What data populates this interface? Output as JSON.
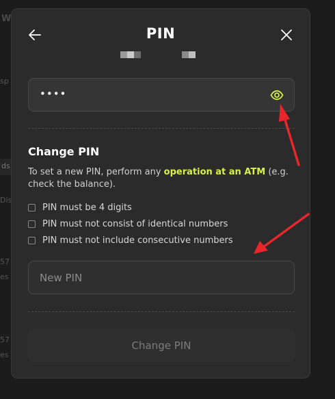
{
  "background": {
    "fragments": [
      "W",
      "sp",
      "ds",
      "Dis",
      "57",
      "es",
      "57",
      "es"
    ]
  },
  "modal": {
    "title": "PIN",
    "back_icon": "arrow-left-icon",
    "close_icon": "close-icon",
    "pin_field": {
      "value": "••••",
      "eye_icon": "eye-icon"
    },
    "change_pin": {
      "heading": "Change PIN",
      "description_prefix": "To set a new PIN, perform any ",
      "description_highlight": "operation at an ATM",
      "description_suffix": " (e.g. check the balance).",
      "highlight_color": "#d8f04a",
      "requirements": [
        "PIN must be 4 digits",
        "PIN must not consist of identical numbers",
        "PIN must not include consecutive numbers"
      ],
      "new_pin_placeholder": "New PIN",
      "submit_label": "Change PIN"
    }
  },
  "annotation_color": "#e8262b"
}
